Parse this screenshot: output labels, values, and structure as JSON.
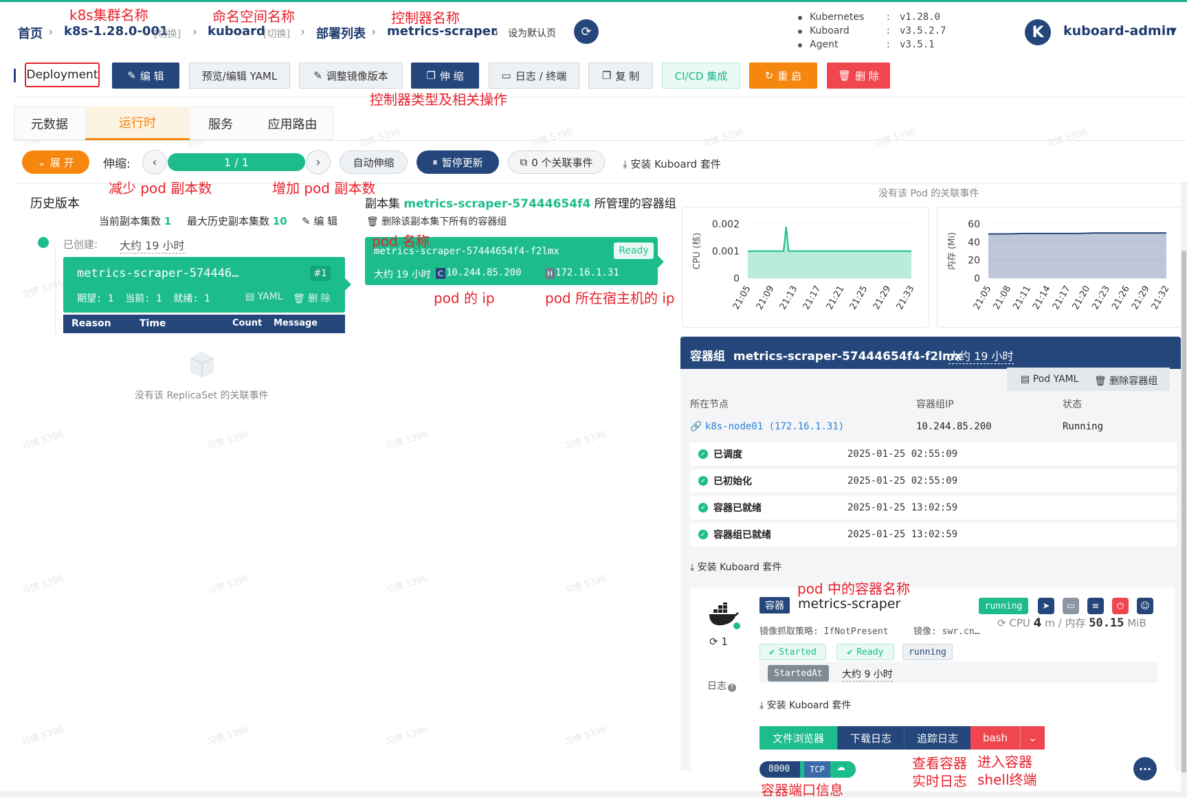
{
  "breadcrumb": {
    "home": "首页",
    "cluster": "k8s-1.28.0-001",
    "cluster_switch": "[切换]",
    "namespace": "kuboard",
    "namespace_switch": "[切换]",
    "list": "部署列表",
    "controller": "metrics-scraper",
    "set_default": "设为默认页"
  },
  "versions": [
    {
      "name": "Kubernetes",
      "sep": ":",
      "value": "v1.28.0"
    },
    {
      "name": "Kuboard",
      "sep": ":",
      "value": "v3.5.2.7"
    },
    {
      "name": "Agent",
      "sep": ":",
      "value": "v3.5.1"
    }
  ],
  "user": {
    "avatar_letter": "K",
    "name": "kuboard-admin"
  },
  "toolbar": {
    "kind": "Deployment",
    "edit": "编 辑",
    "yaml": "预览/编辑 YAML",
    "image": "调整镜像版本",
    "scale": "伸 缩",
    "logs": "日志 / 终端",
    "copy": "复 制",
    "cicd": "CI/CD 集成",
    "restart": "重 启",
    "delete": "删 除"
  },
  "tabs": [
    "元数据",
    "运行时",
    "服务",
    "应用路由"
  ],
  "scalebar": {
    "expand": "展 开",
    "label": "伸缩:",
    "replicas": "1 / 1",
    "auto": "自动伸缩",
    "pause": "暂停更新",
    "events": "0 个关联事件",
    "install": "安装 Kuboard 套件"
  },
  "history": {
    "title": "历史版本",
    "current_label": "当前副本集数",
    "current_value": "1",
    "max_label": "最大历史副本集数",
    "max_value": "10",
    "edit": "编 辑",
    "created_label": "已创建:",
    "created_value": "大约 19 小时",
    "rs_name": "metrics-scraper-574446…",
    "rs_badge": "#1",
    "rs_counts": "期望: 1  当前: 1  就绪: 1",
    "rs_yaml": "YAML",
    "rs_delete": "删 除",
    "table_headers": [
      "Reason",
      "Time",
      "Count",
      "Message"
    ],
    "no_events": "没有该 ReplicaSet 的关联事件"
  },
  "replicaset": {
    "title_prefix": "副本集",
    "name": "metrics-scraper-57444654f4",
    "title_suffix": "所管理的容器组",
    "delete_all": "删除该副本集下所有的容器组",
    "pod_name": "metrics-scraper-57444654f4-f2lmx",
    "pod_status": "Ready",
    "pod_age": "大约 19 小时",
    "pod_ip_badge": "C",
    "pod_ip": "10.244.85.200",
    "host_ip_badge": "H",
    "host_ip": "172.16.1.31"
  },
  "no_pod_events": "没有该 Pod 的关联事件",
  "cpu_chart": {
    "type": "area",
    "ylabel": "CPU (核)",
    "yticks": [
      "0.002",
      "0.001",
      "0"
    ],
    "ylim": [
      0,
      0.002
    ],
    "xticks": [
      "21:05",
      "21:09",
      "21:13",
      "21:17",
      "21:21",
      "21:25",
      "21:29",
      "21:33"
    ],
    "x": [
      0,
      4,
      6,
      7,
      7.5,
      8,
      9,
      12,
      16,
      20,
      24,
      28,
      32
    ],
    "values": [
      0.001,
      0.001,
      0.001,
      0.001,
      0.0019,
      0.001,
      0.001,
      0.001,
      0.001,
      0.001,
      0.001,
      0.001,
      0.001
    ],
    "color": "#1dbc8c"
  },
  "mem_chart": {
    "type": "area",
    "ylabel": "内存 (Mi)",
    "yticks": [
      "60",
      "40",
      "20",
      "0"
    ],
    "ylim": [
      0,
      60
    ],
    "xticks": [
      "21:05",
      "21:08",
      "21:11",
      "21:14",
      "21:17",
      "21:20",
      "21:23",
      "21:26",
      "21:29",
      "21:32"
    ],
    "x": [
      0,
      3,
      6,
      9,
      12,
      15,
      18,
      21,
      24,
      27,
      30
    ],
    "values": [
      49,
      49,
      49.5,
      49.5,
      49.5,
      49.5,
      50,
      50,
      50,
      50,
      50
    ],
    "color": "#24467a"
  },
  "pod": {
    "header_label": "容器组",
    "name": "metrics-scraper-57444654f4-f2lmx",
    "age": "大约 19 小时",
    "yaml": "Pod YAML",
    "delete": "删除容器组",
    "col_node": "所在节点",
    "col_ip": "容器组IP",
    "col_status": "状态",
    "node": "k8s-node01 (172.16.1.31)",
    "ip": "10.244.85.200",
    "status": "Running",
    "conditions": [
      {
        "label": "已调度",
        "time": "2025-01-25 02:55:09"
      },
      {
        "label": "已初始化",
        "time": "2025-01-25 02:55:09"
      },
      {
        "label": "容器已就绪",
        "time": "2025-01-25 13:02:59"
      },
      {
        "label": "容器组已就绪",
        "time": "2025-01-25 13:02:59"
      }
    ],
    "install": "安装 Kuboard 套件"
  },
  "container": {
    "tag": "容器",
    "name": "metrics-scraper",
    "state": "running",
    "pull_policy": "镜像抓取策略: IfNotPresent",
    "image": "镜像: swr.cn…",
    "cpu_label": "CPU",
    "cpu_value": "4",
    "cpu_unit": "m / 内存",
    "mem_value": "50.15",
    "mem_unit": "MiB",
    "restarts": "1",
    "tag_started": "Started",
    "tag_ready": "Ready",
    "tag_running": "running",
    "started_at_label": "StartedAt",
    "started_at_value": "大约 9 小时",
    "logs_label": "日志",
    "install": "安装 Kuboard 套件",
    "btn_files": "文件浏览器",
    "btn_download": "下载日志",
    "btn_tail": "追踪日志",
    "btn_bash": "bash",
    "port": "8000",
    "protocol": "TCP"
  },
  "annotations": {
    "cluster": "k8s集群名称",
    "namespace": "命名空间名称",
    "controller": "控制器名称",
    "ops": "控制器类型及相关操作",
    "decrease": "减少 pod 副本数",
    "increase": "增加 pod 副本数",
    "pod_name": "pod 名称",
    "pod_ip": "pod 的 ip",
    "host_ip": "pod 所在宿主机的 ip",
    "container_name": "pod 中的容器名称",
    "realtime_log_1": "查看容器",
    "realtime_log_2": "实时日志",
    "shell_1": "进入容器",
    "shell_2": "shell终端",
    "port_info": "容器端口信息"
  },
  "watermark": "习惯 5396"
}
